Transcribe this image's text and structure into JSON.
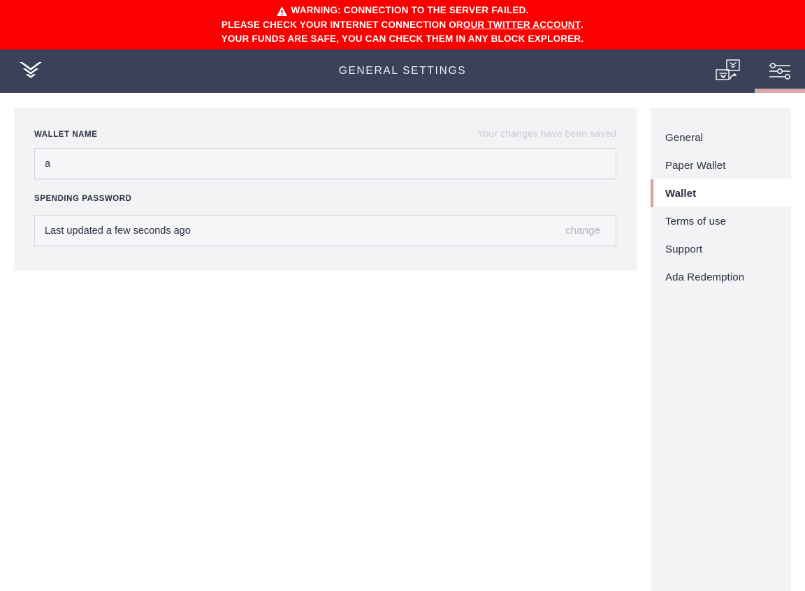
{
  "warning": {
    "icon": "warning-triangle-icon",
    "line1": "WARNING: CONNECTION TO THE SERVER FAILED.",
    "line2_prefix": "PLEASE CHECK YOUR INTERNET CONNECTION OR ",
    "line2_link": "OUR TWITTER ACCOUNT",
    "line2_suffix": ".",
    "line3": "YOUR FUNDS ARE SAFE, YOU CAN CHECK THEM IN ANY BLOCK EXPLORER.",
    "background_color": "#fa0000",
    "text_color": "#ffffff"
  },
  "topbar": {
    "logo_icon": "daedalus-chevron-logo",
    "title": "GENERAL SETTINGS",
    "background_color": "#3a425a",
    "actions": [
      {
        "name": "wallet-switch-icon",
        "label": "Switch wallet",
        "active": false
      },
      {
        "name": "settings-sliders-icon",
        "label": "Settings",
        "active": true
      }
    ],
    "active_indicator_color": "#d9a7a7"
  },
  "content": {
    "wallet_name": {
      "label": "WALLET NAME",
      "value": "a",
      "placeholder": ""
    },
    "saved_message": "Your changes have been saved",
    "spending_password": {
      "label": "SPENDING PASSWORD",
      "status": "Last updated a few seconds ago",
      "action": "change"
    },
    "panel_background": "#f2f3f5"
  },
  "settings_menu": {
    "items": [
      {
        "label": "General",
        "active": false
      },
      {
        "label": "Paper Wallet",
        "active": false
      },
      {
        "label": "Wallet",
        "active": true
      },
      {
        "label": "Terms of use",
        "active": false
      },
      {
        "label": "Support",
        "active": false
      },
      {
        "label": "Ada Redemption",
        "active": false
      }
    ],
    "active_accent_color": "#d9a0a0"
  }
}
